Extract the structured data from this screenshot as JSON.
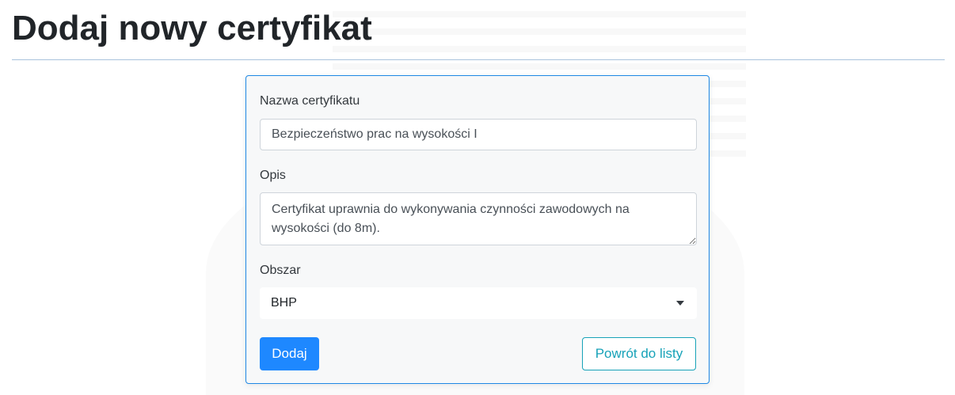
{
  "page": {
    "title": "Dodaj nowy certyfikat"
  },
  "form": {
    "name": {
      "label": "Nazwa certyfikatu",
      "value": "Bezpieczeństwo prac na wysokości I"
    },
    "description": {
      "label": "Opis",
      "value": "Certyfikat uprawnia do wykonywania czynności zawodowych na wysokości (do 8m)."
    },
    "area": {
      "label": "Obszar",
      "selected": "BHP"
    },
    "submit_label": "Dodaj",
    "back_label": "Powrót do listy"
  },
  "colors": {
    "primary": "#1e88ff",
    "info": "#17a2b8",
    "card_border": "#1e88e5"
  },
  "icons": {
    "select_caret": "caret-down-icon"
  }
}
